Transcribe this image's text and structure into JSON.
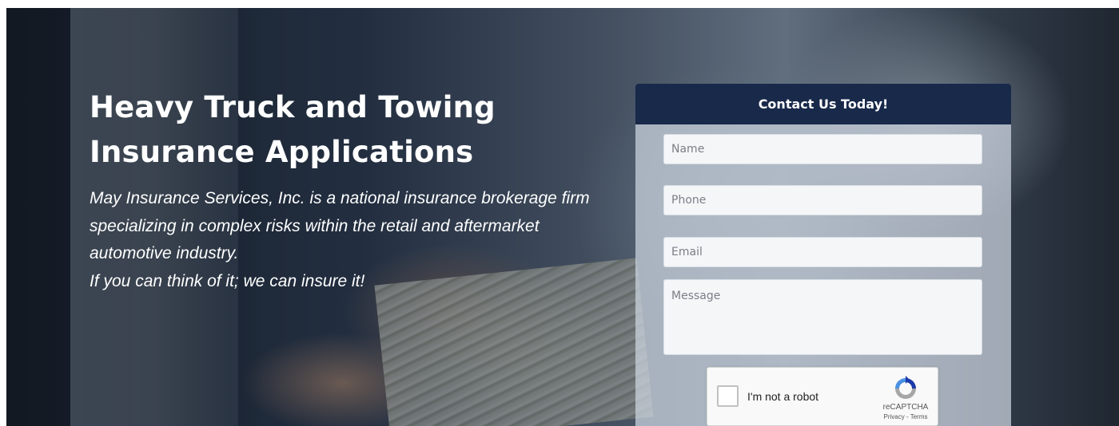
{
  "hero": {
    "headline_line1": "Heavy Truck and Towing",
    "headline_line2": "Insurance Applications",
    "intro": "May Insurance Services, Inc. is a national insurance brokerage firm specializing in complex risks within the retail and aftermarket automotive industry.",
    "tagline": "If you can think of it; we can insure it!"
  },
  "contact_form": {
    "title": "Contact Us Today!",
    "name_placeholder": "Name",
    "phone_placeholder": "Phone",
    "email_placeholder": "Email",
    "message_placeholder": "Message",
    "name_value": "",
    "phone_value": "",
    "email_value": "",
    "message_value": ""
  },
  "recaptcha": {
    "label": "I'm not a robot",
    "brand": "reCAPTCHA",
    "links": "Privacy - Terms",
    "checked": false
  },
  "colors": {
    "form_header": "#18294a",
    "headline_text": "#ffffff",
    "recaptcha_blue": "#1c3aa9",
    "recaptcha_gray": "#a6a6a6",
    "recaptcha_light": "#4a90e2"
  },
  "icons": {
    "recaptcha_logo": "recaptcha-logo-icon",
    "checkbox": "checkbox-icon"
  }
}
